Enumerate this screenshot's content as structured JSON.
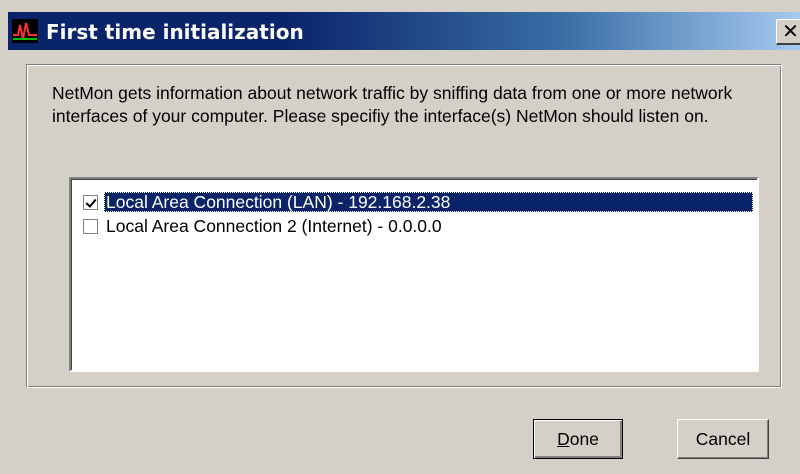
{
  "window": {
    "title": "First time initialization",
    "close_glyph": "✕",
    "icon": "netmon-app-icon"
  },
  "description": "NetMon gets information about network traffic by sniffing data from one or more network interfaces of your computer. Please specifiy the interface(s) NetMon should listen on.",
  "interfaces": [
    {
      "label": "Local Area Connection (LAN) - 192.168.2.38",
      "checked": true,
      "selected": true
    },
    {
      "label": "Local Area Connection 2 (Internet) - 0.0.0.0",
      "checked": false,
      "selected": false
    }
  ],
  "buttons": {
    "done_mnemonic": "D",
    "done_rest": "one",
    "cancel": "Cancel"
  },
  "colors": {
    "titlebar": "#0a246a",
    "selection": "#0a246a",
    "face": "#d4d0c8"
  }
}
